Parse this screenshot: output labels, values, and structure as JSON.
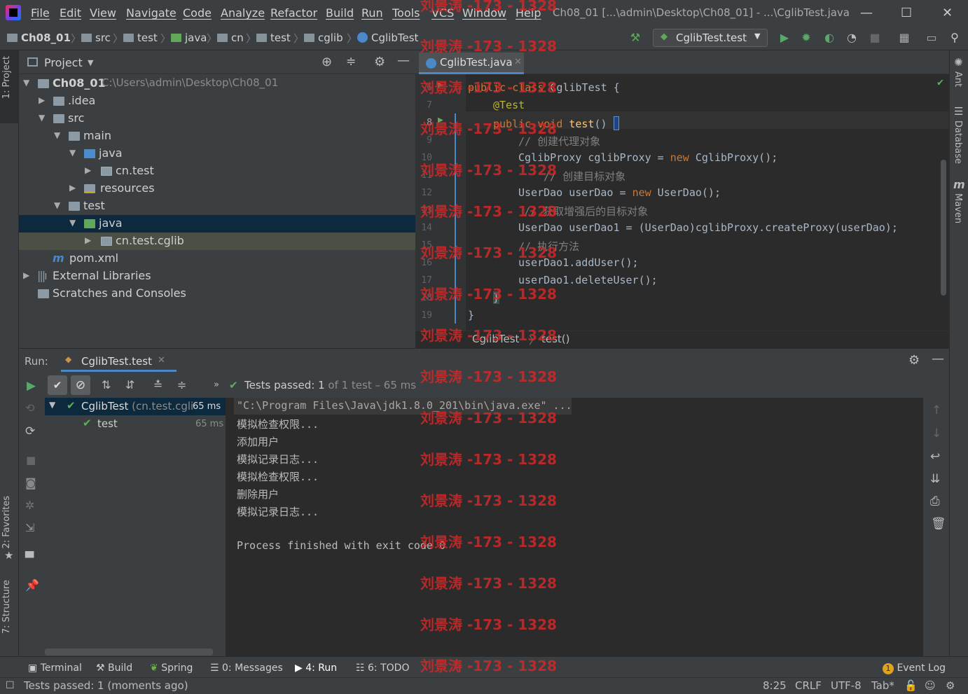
{
  "menu": [
    "File",
    "Edit",
    "View",
    "Navigate",
    "Code",
    "Analyze",
    "Refactor",
    "Build",
    "Run",
    "Tools",
    "VCS",
    "Window",
    "Help"
  ],
  "window_title": "Ch08_01 [...\\admin\\Desktop\\Ch08_01] - ...\\CglibTest.java",
  "breadcrumbs": [
    "Ch08_01",
    "src",
    "test",
    "java",
    "cn",
    "test",
    "cglib",
    "CglibTest"
  ],
  "run_config": "CglibTest.test",
  "left_tabs": {
    "project": "1: Project",
    "favorites": "2: Favorites",
    "structure": "7: Structure"
  },
  "right_tabs": {
    "ant": "Ant",
    "database": "Database",
    "maven": "Maven"
  },
  "project": {
    "title": "Project",
    "root_name": "Ch08_01",
    "root_path": "C:\\Users\\admin\\Desktop\\Ch08_01",
    "items": [
      ".idea",
      "src",
      "main",
      "java",
      "cn.test",
      "resources",
      "test",
      "java",
      "cn.test.cglib",
      "pom.xml",
      "External Libraries",
      "Scratches and Consoles"
    ]
  },
  "editor": {
    "tab": "CglibTest.java",
    "line_numbers": [
      "6",
      "7",
      "8",
      "9",
      "10",
      "11",
      "12",
      "13",
      "14",
      "15",
      "16",
      "17",
      "18",
      "19"
    ],
    "code": {
      "l6_kw": "public class",
      "l6_name": " CglibTest {",
      "l7": "@Test",
      "l8_kw": "public void",
      "l8_fn": "test",
      "l8_rest": "() ",
      "l9": "// 创建代理对象",
      "l10_a": "CglibProxy cglibProxy = ",
      "l10_kw": "new",
      "l10_b": " CglibProxy();",
      "l11": "// 创建目标对象",
      "l12_a": "UserDao userDao = ",
      "l12_kw": "new",
      "l12_b": " UserDao();",
      "l13": "// 获取增强后的目标对象",
      "l14": "UserDao userDao1 = (UserDao)cglibProxy.createProxy(userDao);",
      "l15": "// 执行方法",
      "l16": "userDao1.addUser();",
      "l17": "userDao1.deleteUser();",
      "l18": "}",
      "l19": "}"
    },
    "crumbs": [
      "CglibTest",
      "test()"
    ]
  },
  "run": {
    "label": "Run:",
    "tab": "CglibTest.test",
    "status_prefix": "Tests passed:",
    "status_count": "1",
    "status_suffix": "of 1 test – 65 ms",
    "tree": [
      {
        "name": "CglibTest",
        "detail": "(cn.test.cgli",
        "time": "65 ms"
      },
      {
        "name": "test",
        "detail": "",
        "time": "65 ms"
      }
    ],
    "console": [
      "\"C:\\Program Files\\Java\\jdk1.8.0_201\\bin\\java.exe\" ...",
      "模拟检查权限...",
      "添加用户",
      "模拟记录日志...",
      "模拟检查权限...",
      "删除用户",
      "模拟记录日志...",
      "",
      "Process finished with exit code 0"
    ]
  },
  "tool_tabs": [
    "Terminal",
    "Build",
    "Spring",
    "0: Messages",
    "4: Run",
    "6: TODO"
  ],
  "event_log": {
    "count": "1",
    "label": "Event Log"
  },
  "status": {
    "message": "Tests passed: 1 (moments ago)",
    "position": "8:25",
    "line_sep": "CRLF",
    "encoding": "UTF-8",
    "indent": "Tab*"
  },
  "watermark": "刘景涛 -173 - 1328",
  "colors": {
    "keyword": "#cc7832",
    "annotation": "#bbb529",
    "comment": "#808080",
    "selection": "#0d293e",
    "accent": "#4a88c7",
    "pass": "#5fb05a"
  }
}
